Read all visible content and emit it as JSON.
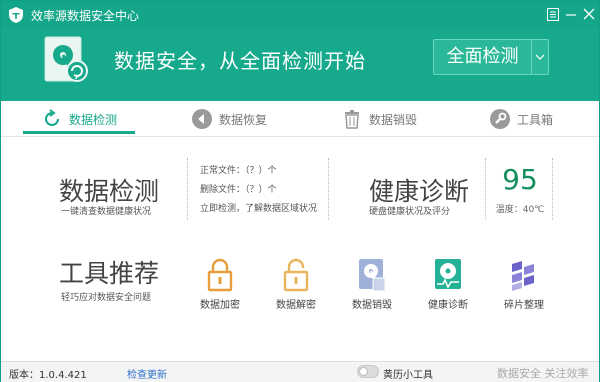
{
  "window": {
    "title": "效率源数据安全中心"
  },
  "banner": {
    "slogan": "数据安全，从全面检测开始",
    "scan_button": "全面检测"
  },
  "tabs": [
    {
      "label": "数据检测",
      "icon": "refresh-icon",
      "active": true
    },
    {
      "label": "数据恢复",
      "icon": "back-arrow-icon",
      "active": false
    },
    {
      "label": "数据销毁",
      "icon": "trash-icon",
      "active": false
    },
    {
      "label": "工具箱",
      "icon": "wrench-icon",
      "active": false
    }
  ],
  "detect": {
    "title": "数据检测",
    "subtitle": "一键清查数据健康状况",
    "lines": [
      "正常文件：（？）个",
      "删除文件：（？）个",
      "立即检测，了解数据区域状况"
    ]
  },
  "health": {
    "title": "健康诊断",
    "subtitle": "硬盘健康状况及评分",
    "score": "95",
    "temperature": "温度：40℃"
  },
  "tools": {
    "title": "工具推荐",
    "subtitle": "轻巧应对数据安全问题",
    "items": [
      {
        "label": "数据加密",
        "icon": "lock-closed-icon"
      },
      {
        "label": "数据解密",
        "icon": "lock-open-icon"
      },
      {
        "label": "数据销毁",
        "icon": "disk-shred-icon"
      },
      {
        "label": "健康诊断",
        "icon": "disk-health-icon"
      },
      {
        "label": "碎片整理",
        "icon": "defrag-icon"
      }
    ]
  },
  "statusbar": {
    "version": "版本：1.0.4.421",
    "check_update": "检查更新",
    "calendar_tool": "黄历小工具",
    "footer_slogan": "数据安全 关注效率源"
  },
  "colors": {
    "brand": "#16a98b",
    "score": "#14905f",
    "link": "#2f70c9"
  }
}
